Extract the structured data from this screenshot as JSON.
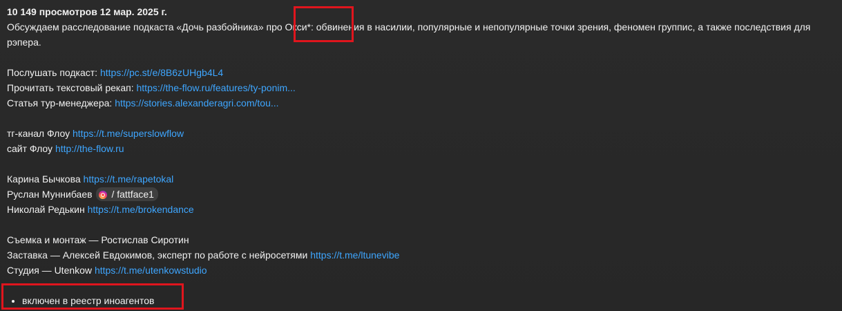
{
  "meta": {
    "views": "10 149 просмотров",
    "date": "12 мар. 2025 г."
  },
  "intro": "Обсуждаем расследование подкаста «Дочь разбойника» про Окси*: обвинения в насилии, популярные и непопулярные точки зрения, феномен группис, а также последствия для рэпера.",
  "links": [
    {
      "label": "Послушать подкаст:",
      "url": "https://pc.st/e/8B6zUHgb4L4"
    },
    {
      "label": "Прочитать текстовый рекап:",
      "url": "https://the-flow.ru/features/ty-ponim..."
    },
    {
      "label": "Статья тур-менеджера:",
      "url": "https://stories.alexanderagri.com/tou..."
    }
  ],
  "flow": [
    {
      "label": "тг-канал Флоу",
      "url": "https://t.me/superslowflow"
    },
    {
      "label": "сайт Флоу",
      "url": "http://the-flow.ru"
    }
  ],
  "people": [
    {
      "label": "Карина Бычкова",
      "url": "https://t.me/rapetokal"
    },
    {
      "label": "Руслан Муннибаев",
      "chip": "/ fattface1",
      "chip_icon": "instagram-icon"
    },
    {
      "label": "Николай Редькин",
      "url": "https://t.me/brokendance"
    }
  ],
  "credits": [
    {
      "label": "Съемка и монтаж — Ростислав Сиротин",
      "url": ""
    },
    {
      "label": "Заставка — Алексей Евдокимов, эксперт по работе с нейросетями",
      "url": "https://t.me/ltunevibe"
    },
    {
      "label": "Студия — Utenkow",
      "url": "https://t.me/utenkowstudio"
    }
  ],
  "footnote": "включен в реестр иноагентов",
  "colors": {
    "background": "#272727",
    "text": "#f1f1f1",
    "link": "#3ea6ff",
    "highlight": "#e0151d"
  }
}
